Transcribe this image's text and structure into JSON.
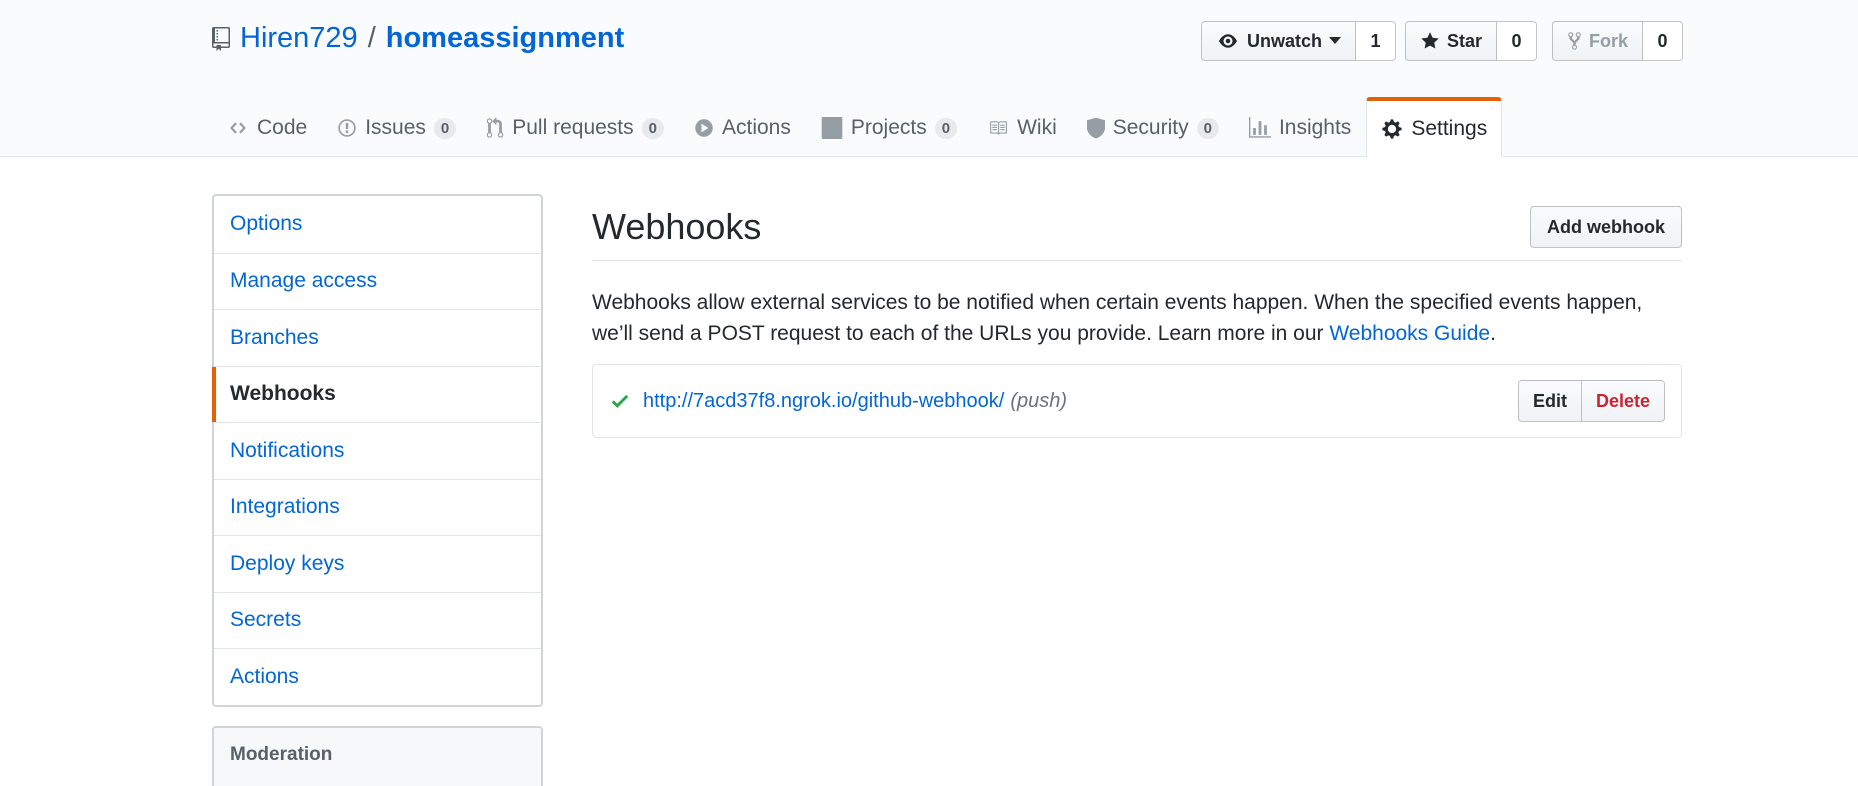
{
  "repo": {
    "owner": "Hiren729",
    "separator": "/",
    "name": "homeassignment"
  },
  "actions": {
    "watch": {
      "label": "Unwatch",
      "count": "1"
    },
    "star": {
      "label": "Star",
      "count": "0"
    },
    "fork": {
      "label": "Fork",
      "count": "0"
    }
  },
  "tabs": [
    {
      "label": "Code",
      "icon": "code-icon"
    },
    {
      "label": "Issues",
      "count": "0",
      "icon": "issue-icon"
    },
    {
      "label": "Pull requests",
      "count": "0",
      "icon": "pull-request-icon"
    },
    {
      "label": "Actions",
      "icon": "play-icon"
    },
    {
      "label": "Projects",
      "count": "0",
      "icon": "project-icon"
    },
    {
      "label": "Wiki",
      "icon": "book-icon"
    },
    {
      "label": "Security",
      "count": "0",
      "icon": "shield-icon"
    },
    {
      "label": "Insights",
      "icon": "graph-icon"
    },
    {
      "label": "Settings",
      "icon": "gear-icon",
      "selected": true
    }
  ],
  "sidebar": {
    "items": [
      {
        "label": "Options"
      },
      {
        "label": "Manage access"
      },
      {
        "label": "Branches"
      },
      {
        "label": "Webhooks",
        "selected": true
      },
      {
        "label": "Notifications"
      },
      {
        "label": "Integrations"
      },
      {
        "label": "Deploy keys"
      },
      {
        "label": "Secrets"
      },
      {
        "label": "Actions"
      }
    ],
    "moderation_label": "Moderation"
  },
  "main": {
    "title": "Webhooks",
    "add_button": "Add webhook",
    "description_text": "Webhooks allow external services to be notified when certain events happen. When the specified events happen, we’ll send a POST request to each of the URLs you provide. Learn more in our ",
    "guide_link": "Webhooks Guide",
    "description_end": ".",
    "hooks": [
      {
        "url": "http://7acd37f8.ngrok.io/github-webhook/",
        "events": "(push)",
        "status": "success",
        "edit_label": "Edit",
        "delete_label": "Delete"
      }
    ]
  },
  "colors": {
    "link": "#0366d6",
    "accent": "#e36209",
    "success": "#28a745",
    "danger": "#cb2431"
  }
}
